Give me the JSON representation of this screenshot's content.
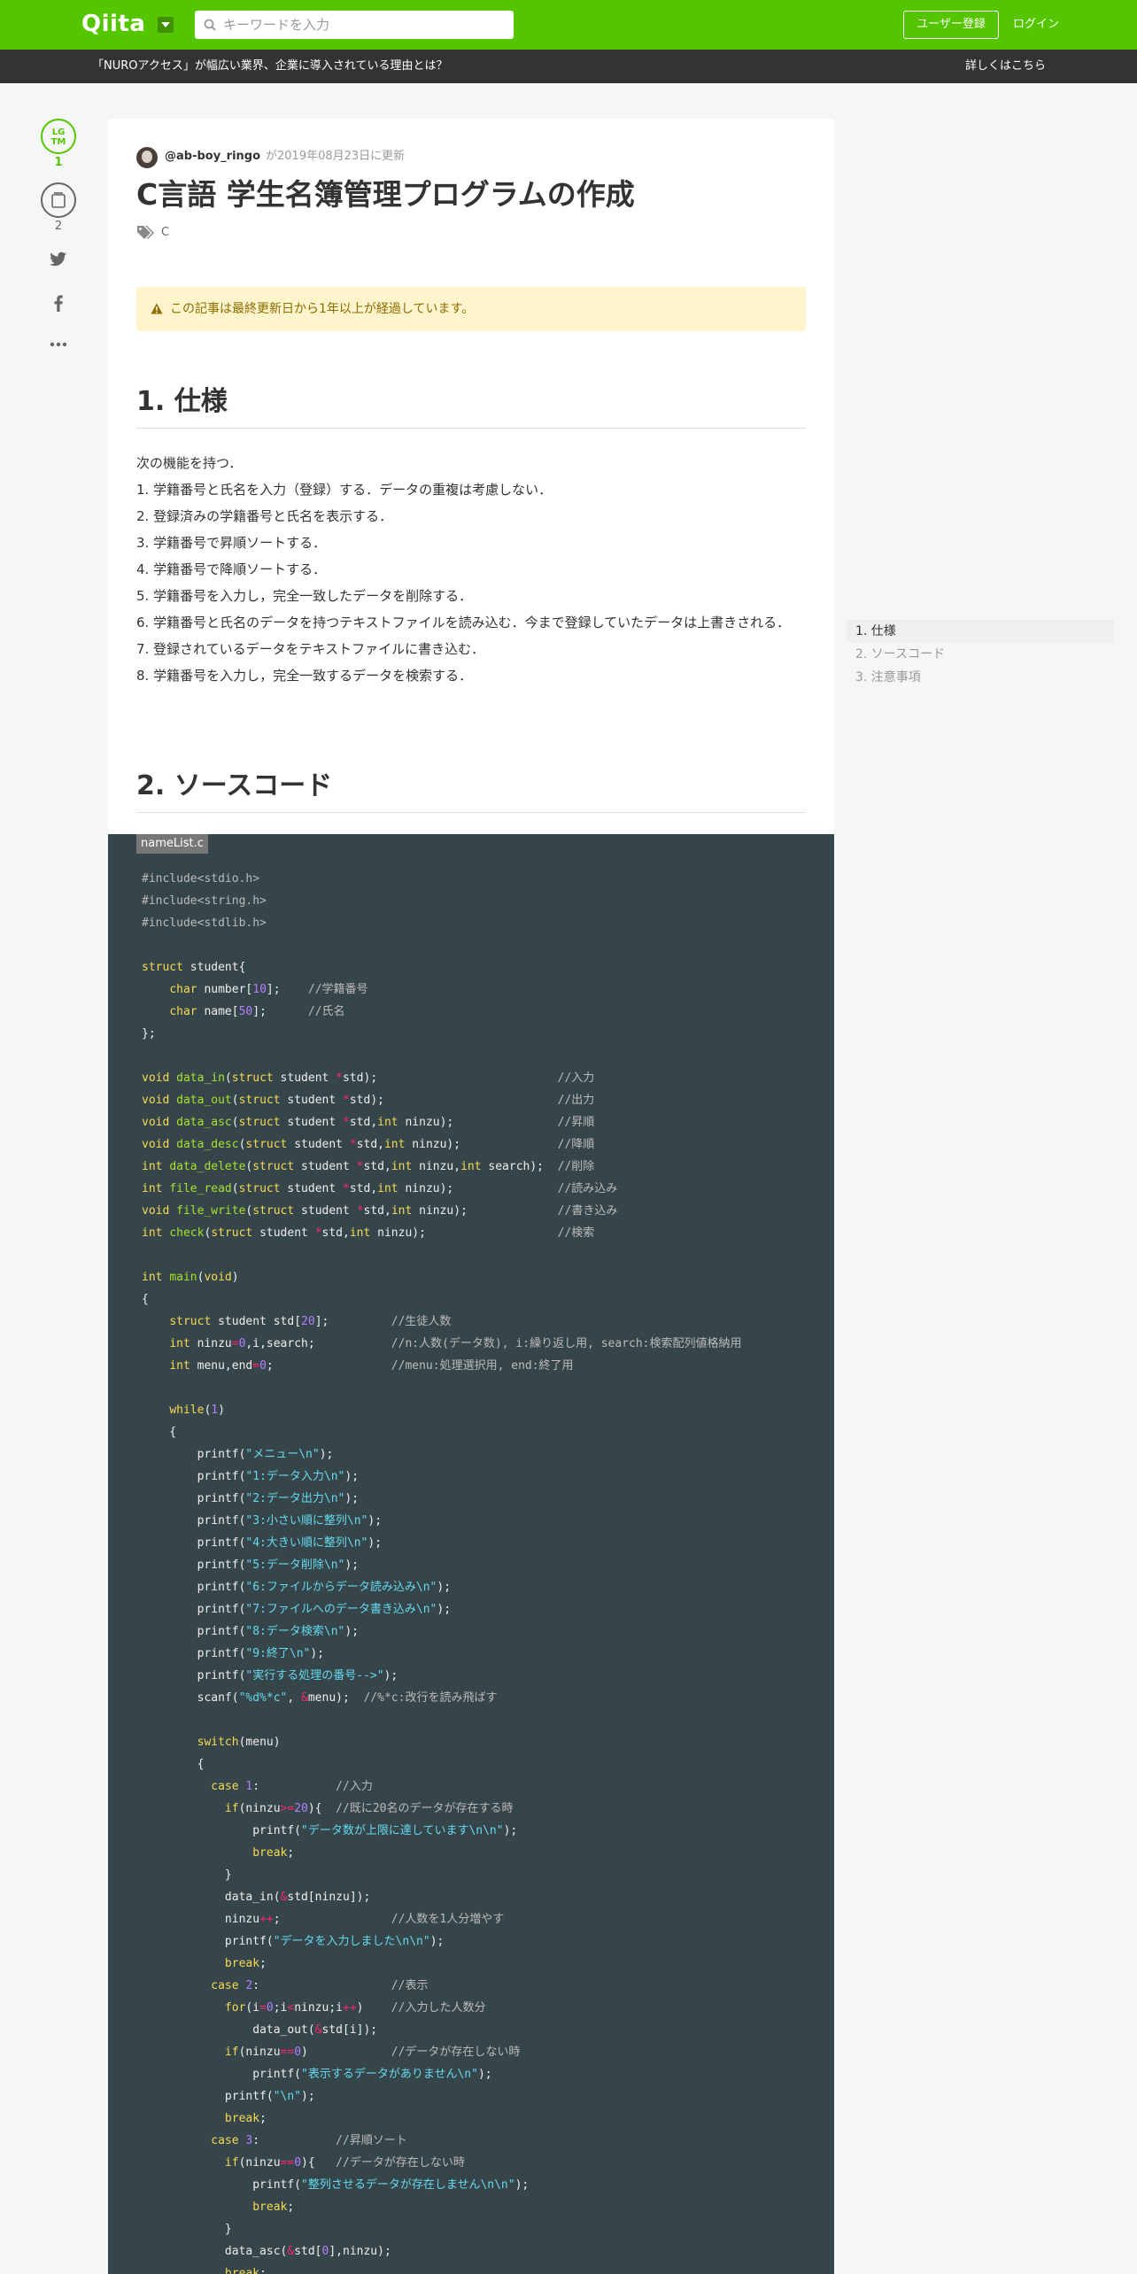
{
  "header": {
    "logo": "Qiita",
    "search_placeholder": "キーワードを入力",
    "signup_label": "ユーザー登録",
    "login_label": "ログイン"
  },
  "adbar": {
    "text": "「NUROアクセス」が幅広い業界、企業に導入されている理由とは？",
    "link": "詳しくはこちら"
  },
  "actions": {
    "lgtm_line1": "LG",
    "lgtm_line2": "TM",
    "lgtm_count": "1",
    "stock_count": "2"
  },
  "article": {
    "author": "@ab-boy_ringo",
    "updated": "が2019年08月23日に更新",
    "title": "C言語 学生名簿管理プログラムの作成",
    "tag": "C",
    "notice": "この記事は最終更新日から1年以上が経過しています。",
    "section1_heading": "1. 仕様",
    "section1_lines": [
      "次の機能を持つ．",
      "1. 学籍番号と氏名を入力（登録）する．データの重複は考慮しない．",
      "2. 登録済みの学籍番号と氏名を表示する．",
      "3. 学籍番号で昇順ソートする．",
      "4. 学籍番号で降順ソートする．",
      "5. 学籍番号を入力し，完全一致したデータを削除する．",
      "6. 学籍番号と氏名のデータを持つテキストファイルを読み込む．今まで登録していたデータは上書きされる．",
      "7. 登録されているデータをテキストファイルに書き込む．",
      "8. 学籍番号を入力し，完全一致するデータを検索する．"
    ],
    "section2_heading": "2. ソースコード",
    "code_filename": "nameList.c"
  },
  "toc": {
    "items": [
      "1. 仕様",
      "2. ソースコード",
      "3. 注意事項"
    ]
  },
  "colors": {
    "brand": "#55c500",
    "code_bg": "#364549"
  }
}
